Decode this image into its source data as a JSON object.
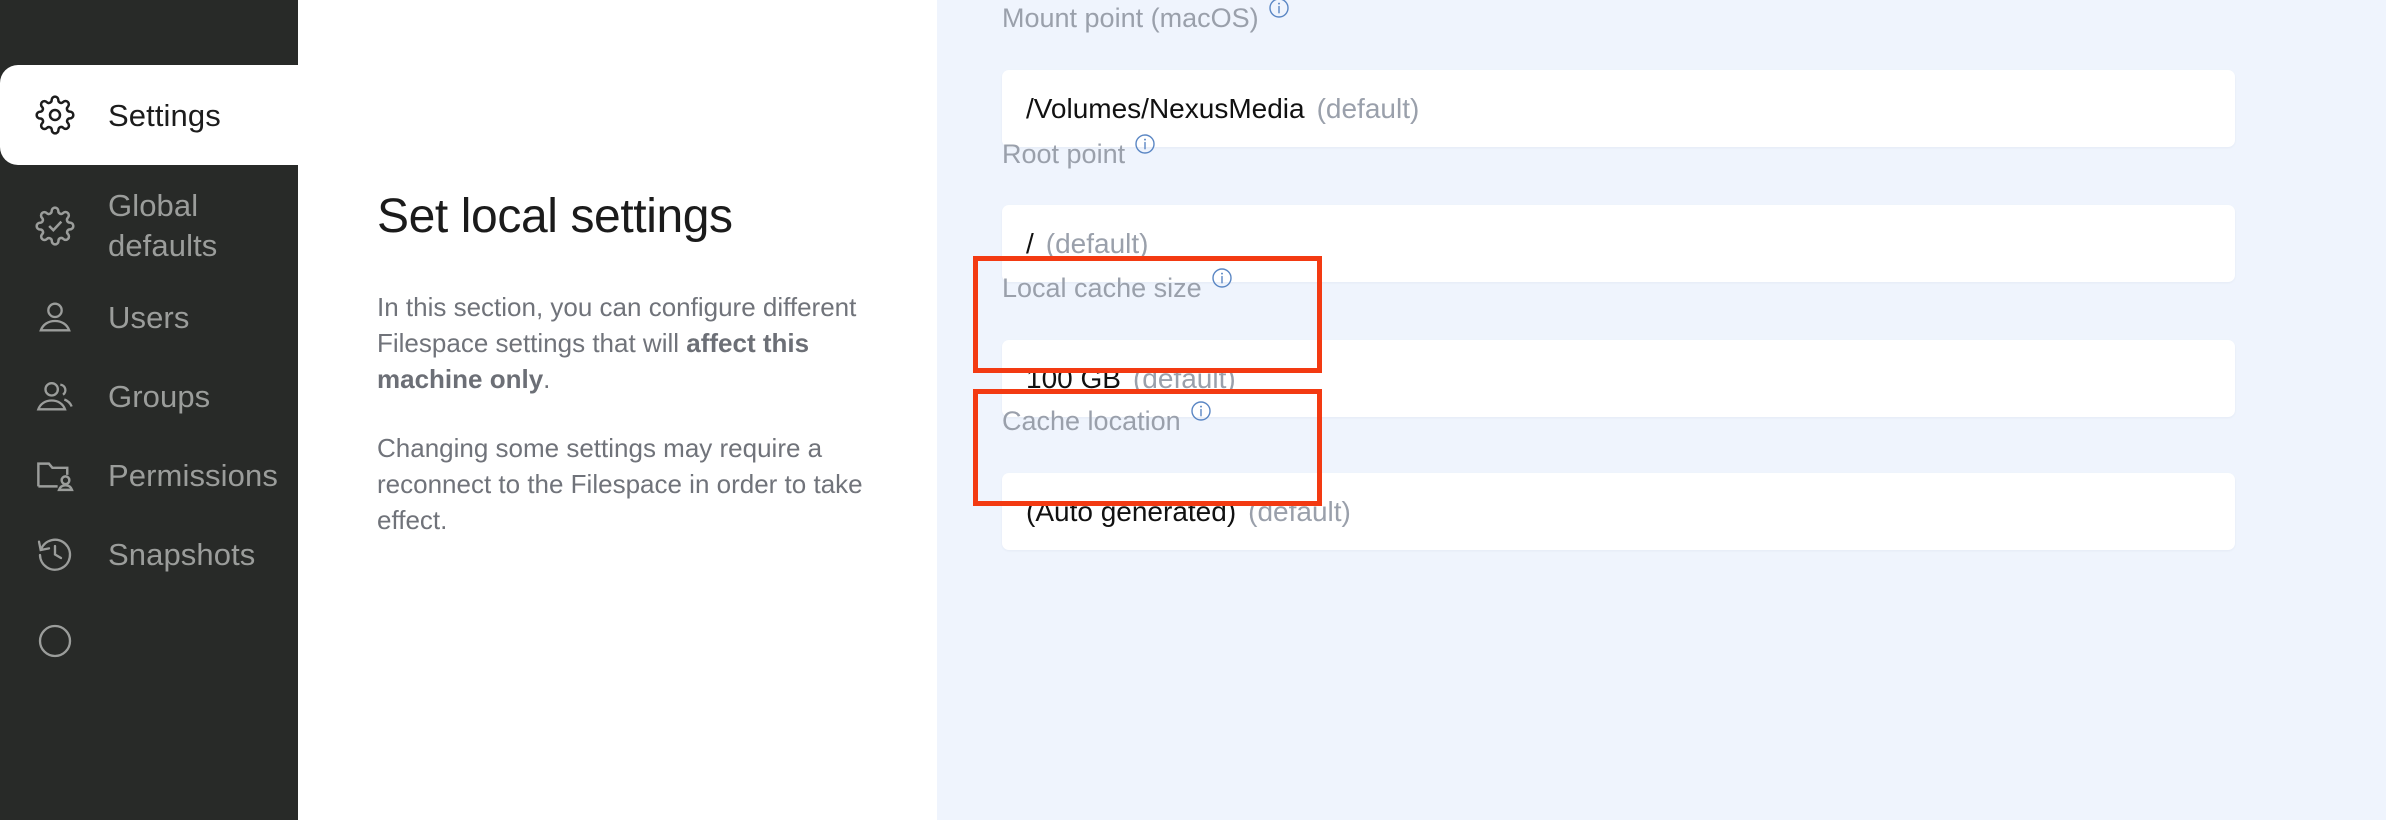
{
  "sidebar": {
    "background_color": "#282a28",
    "active_background_color": "#ffffff",
    "items": [
      {
        "id": "settings",
        "label": "Settings",
        "icon": "gear-icon",
        "active": true
      },
      {
        "id": "global",
        "label": "Global\ndefaults",
        "icon": "gear-check-icon",
        "active": false
      },
      {
        "id": "users",
        "label": "Users",
        "icon": "user-icon",
        "active": false
      },
      {
        "id": "groups",
        "label": "Groups",
        "icon": "users-group-icon",
        "active": false
      },
      {
        "id": "perms",
        "label": "Permissions",
        "icon": "folder-user-icon",
        "active": false
      },
      {
        "id": "snapshots",
        "label": "Snapshots",
        "icon": "clock-rewind-icon",
        "active": false
      }
    ],
    "global_defaults_line1": "Global",
    "global_defaults_line2": "defaults"
  },
  "intro": {
    "title": "Set local settings",
    "paragraph1_a": "In this section, you can configure different Filespace settings that will ",
    "paragraph1_bold": "affect this machine only",
    "paragraph1_b": ".",
    "paragraph2": "Changing some settings may require a reconnect to the Filespace in order to take effect."
  },
  "settings_panel": {
    "background_color": "#eff4fd",
    "info_icon_color": "#5b87c4",
    "highlight_color": "#f33a12",
    "default_tag": "(default)",
    "fields": [
      {
        "id": "mount-point",
        "label": "Mount point (macOS)",
        "value": "/Volumes/NexusMedia",
        "default_tag": "(default)",
        "info_icon": "info-circle-icon",
        "highlighted": false
      },
      {
        "id": "root-point",
        "label": "Root point",
        "value": "/",
        "default_tag": "(default)",
        "info_icon": "info-circle-icon",
        "highlighted": false
      },
      {
        "id": "local-cache-size",
        "label": "Local cache size",
        "value": "100 GB",
        "default_tag": "(default)",
        "info_icon": "info-circle-icon",
        "highlighted": true
      },
      {
        "id": "cache-location",
        "label": "Cache location",
        "value": "(Auto generated)",
        "default_tag": "(default)",
        "info_icon": "info-circle-icon",
        "highlighted": true
      }
    ]
  }
}
